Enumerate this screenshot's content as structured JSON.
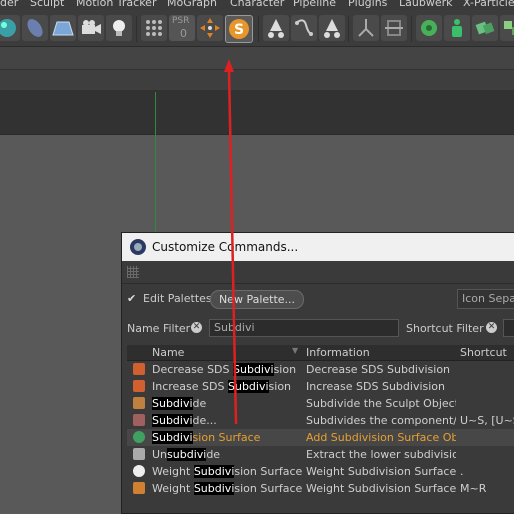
{
  "menu": [
    "der",
    "Sculpt",
    "Motion Tracker",
    "MoGraph",
    "Character",
    "Pipeline",
    "Plugins",
    "Laubwerk",
    "X-Particles"
  ],
  "toolbar_icons": [
    "sphere-icon",
    "cube-icon",
    "floor-grid-icon",
    "camera-icon",
    "light-icon",
    "array-icon",
    "psr-icon",
    "transform-icon",
    "subdivision-s-icon",
    "cone-icon",
    "spline-icon",
    "cone-icon",
    "ik-icon",
    "deformer-icon",
    "mograph-icon",
    "figure-icon",
    "cubes-icon",
    "blocks-icon"
  ],
  "psr_label": "PSR",
  "psr_value": "0",
  "dialog": {
    "title": "Customize Commands...",
    "edit_palettes": "Edit Palettes",
    "new_palette": "New Palette...",
    "icon_separator": "Icon Separ",
    "name_filter_label": "Name Filter",
    "name_filter_value": "Subdivi",
    "shortcut_filter_label": "Shortcut Filter",
    "columns": {
      "name": "Name",
      "information": "Information",
      "shortcut": "Shortcut"
    },
    "rows": [
      {
        "icon": "decrease-sds-icon",
        "pre": "Decrease SDS ",
        "hl": "Subdivi",
        "post": "sion",
        "info": "Decrease SDS Subdivision",
        "shortcut": "",
        "selected": false
      },
      {
        "icon": "increase-sds-icon",
        "pre": "Increase SDS ",
        "hl": "Subdivi",
        "post": "sion",
        "info": "Increase SDS Subdivision",
        "shortcut": "",
        "selected": false
      },
      {
        "icon": "subdivide-icon",
        "pre": "",
        "hl": "Subdivi",
        "post": "de",
        "info": "Subdivide the Sculpt Object u",
        "shortcut": "",
        "selected": false
      },
      {
        "icon": "subdivide-component-icon",
        "pre": "",
        "hl": "Subdivi",
        "post": "de...",
        "info": "Subdivides the component/o",
        "shortcut": "U~S, [U~SI",
        "selected": false
      },
      {
        "icon": "subdivision-surface-icon",
        "pre": "",
        "hl": "Subdivi",
        "post": "sion Surface",
        "info": "Add Subdivision Surface Obje",
        "shortcut": "",
        "selected": true
      },
      {
        "icon": "unsubdivide-icon",
        "pre": "Un",
        "hl": "subdivi",
        "post": "de",
        "info": "Extract the lower subdivision",
        "shortcut": "",
        "selected": false
      },
      {
        "icon": "weight-subdivision-icon",
        "pre": "Weight ",
        "hl": "Subdivi",
        "post": "sion Surface",
        "info": "Weight Subdivision Surface",
        "shortcut": ".",
        "selected": false
      },
      {
        "icon": "weight-subdivision-tool-icon",
        "pre": "Weight ",
        "hl": "Subdivi",
        "post": "sion Surface",
        "info": "Weight Subdivision Surface",
        "shortcut": "M~R",
        "selected": false
      }
    ]
  }
}
